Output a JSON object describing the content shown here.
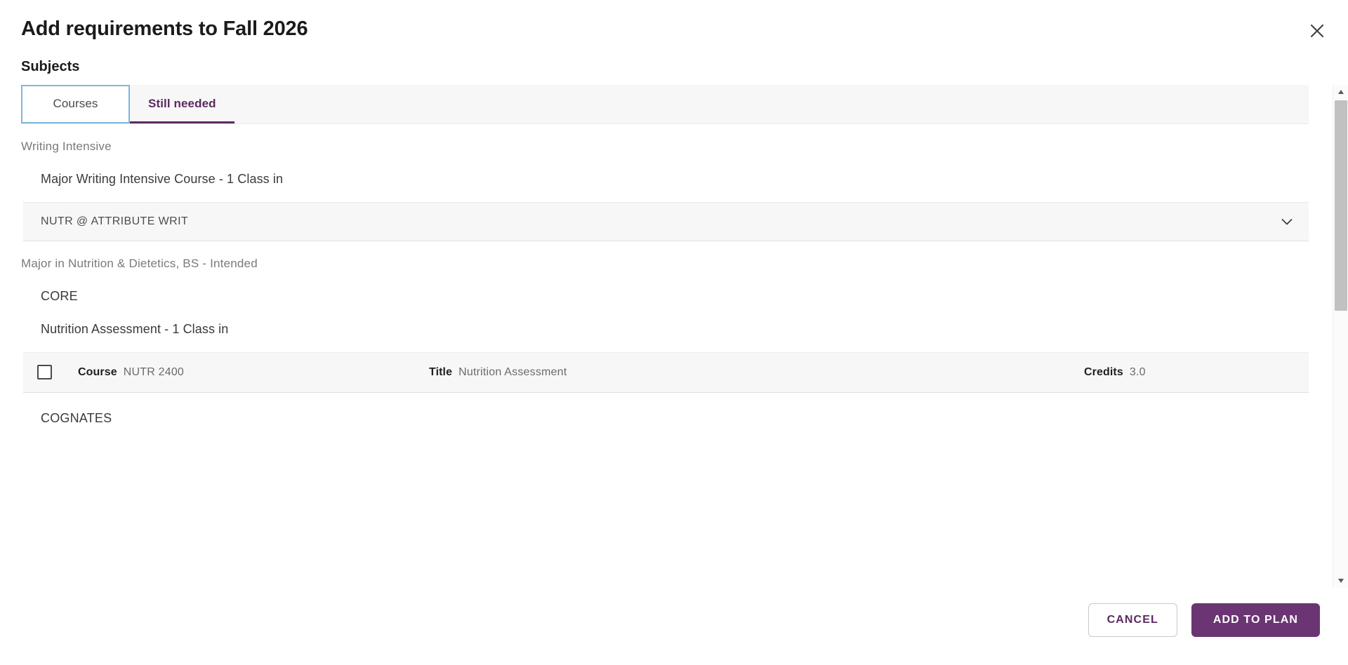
{
  "dialog": {
    "title": "Add requirements to Fall 2026",
    "close_icon": "close-icon",
    "subjects_label": "Subjects"
  },
  "tabs": [
    {
      "label": "Courses",
      "state": "focused"
    },
    {
      "label": "Still needed",
      "state": "active"
    }
  ],
  "sections": [
    {
      "heading": "Writing Intensive",
      "requirement": "Major Writing Intensive Course - 1 Class in",
      "attribute_row": {
        "label": "NUTR @ ATTRIBUTE WRIT",
        "expand_icon": "chevron-down-icon"
      }
    },
    {
      "heading": "Major in Nutrition & Dietetics, BS - Intended",
      "group": "CORE",
      "requirement": "Nutrition Assessment - 1 Class in",
      "course_row": {
        "checked": false,
        "course_key": "Course",
        "course_value": "NUTR 2400",
        "title_key": "Title",
        "title_value": "Nutrition Assessment",
        "credits_key": "Credits",
        "credits_value": "3.0"
      },
      "group2": "COGNATES"
    }
  ],
  "scrollbar": {
    "up_icon": "scroll-up-arrow-icon",
    "down_icon": "scroll-down-arrow-icon"
  },
  "footer": {
    "cancel_label": "CANCEL",
    "add_label": "ADD TO PLAN"
  },
  "colors": {
    "accent": "#6b3573",
    "accent_text": "#5c2a60",
    "focus_ring": "#7eb7dd",
    "row_bg": "#f7f7f7"
  }
}
